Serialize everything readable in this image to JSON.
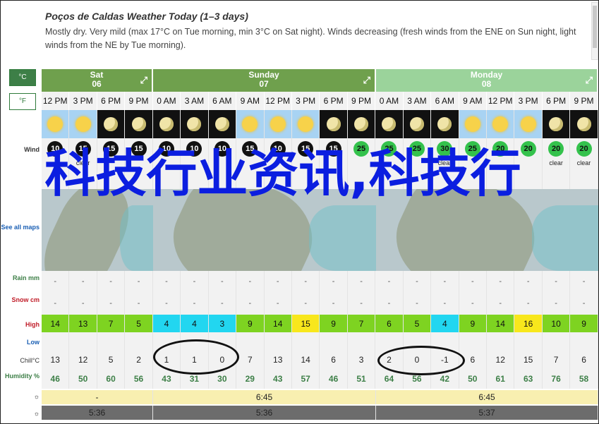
{
  "header": {
    "title": "Poços de Caldas Weather Today (1–3 days)",
    "summary": "Mostly dry. Very mild (max 17°C on Tue morning, min 3°C on Sat night). Winds decreasing (fresh winds from the ENE on Sun night, light winds from the NE by Tue morning)."
  },
  "units": {
    "celsius": "°C",
    "fahrenheit": "°F"
  },
  "days": [
    {
      "name": "Sat",
      "date": "06",
      "expand_icon": "expand-arrows-icon"
    },
    {
      "name": "Sunday",
      "date": "07",
      "expand_icon": "expand-arrows-icon"
    },
    {
      "name": "Monday",
      "date": "08",
      "expand_icon": "expand-arrows-icon"
    }
  ],
  "times": [
    "12 PM",
    "3 PM",
    "6 PM",
    "9 PM",
    "0 AM",
    "3 AM",
    "6 AM",
    "9 AM",
    "12 PM",
    "3 PM",
    "6 PM",
    "9 PM",
    "0 AM",
    "3 AM",
    "6 AM",
    "9 AM",
    "12 PM",
    "3 PM",
    "6 PM",
    "9 PM"
  ],
  "sky": [
    "sun",
    "sun",
    "moon",
    "moon",
    "moon",
    "moon",
    "moon",
    "sun",
    "sun",
    "sun",
    "moon",
    "moon",
    "moon",
    "moon",
    "moon",
    "sun",
    "sun",
    "sun",
    "moon",
    "moon"
  ],
  "labels": {
    "wind": "Wind",
    "maps": "See all maps",
    "rain": "Rain mm",
    "snow": "Snow cm",
    "high": "High",
    "low": "Low",
    "chill": "Chill°C",
    "humidity": "Humidity %"
  },
  "wind_speed": [
    "10",
    "15",
    "15",
    "15",
    "10",
    "10",
    "10",
    "15",
    "10",
    "15",
    "15",
    "25",
    "25",
    "25",
    "30",
    "25",
    "20",
    "20",
    "20",
    "20"
  ],
  "wind_text": [
    "",
    "clear",
    "",
    "",
    "",
    "",
    "",
    "",
    "",
    "",
    "",
    "",
    "",
    "",
    "clear",
    "",
    "",
    "",
    "clear",
    "clear"
  ],
  "rain": [
    "-",
    "-",
    "-",
    "-",
    "-",
    "-",
    "-",
    "-",
    "-",
    "-",
    "-",
    "-",
    "-",
    "-",
    "-",
    "-",
    "-",
    "-",
    "-",
    "-"
  ],
  "snow": [
    "-",
    "-",
    "-",
    "-",
    "-",
    "-",
    "-",
    "-",
    "-",
    "-",
    "-",
    "-",
    "-",
    "-",
    "-",
    "-",
    "-",
    "-",
    "-",
    "-"
  ],
  "high": [
    "14",
    "13",
    "7",
    "5",
    "4",
    "4",
    "3",
    "9",
    "14",
    "15",
    "9",
    "7",
    "6",
    "5",
    "4",
    "9",
    "14",
    "16",
    "10",
    "9"
  ],
  "high_colors": [
    "#7ed321",
    "#7ed321",
    "#7ed321",
    "#7ed321",
    "#22d6f0",
    "#22d6f0",
    "#22d6f0",
    "#7ed321",
    "#7ed321",
    "#f8e71c",
    "#7ed321",
    "#7ed321",
    "#7ed321",
    "#7ed321",
    "#22d6f0",
    "#7ed321",
    "#7ed321",
    "#f8e71c",
    "#7ed321",
    "#7ed321"
  ],
  "chill": [
    "13",
    "12",
    "5",
    "2",
    "1",
    "1",
    "0",
    "7",
    "13",
    "14",
    "6",
    "3",
    "2",
    "0",
    "-1",
    "6",
    "12",
    "15",
    "7",
    "6"
  ],
  "humidity": [
    "46",
    "50",
    "60",
    "56",
    "43",
    "31",
    "30",
    "29",
    "43",
    "57",
    "46",
    "51",
    "64",
    "56",
    "42",
    "50",
    "61",
    "63",
    "76",
    "58"
  ],
  "sunrise": [
    "-",
    "6:45",
    "6:45"
  ],
  "sunset": [
    "5:36",
    "5:36",
    "5:37"
  ],
  "overlay_text": "科技行业资讯,科技行"
}
